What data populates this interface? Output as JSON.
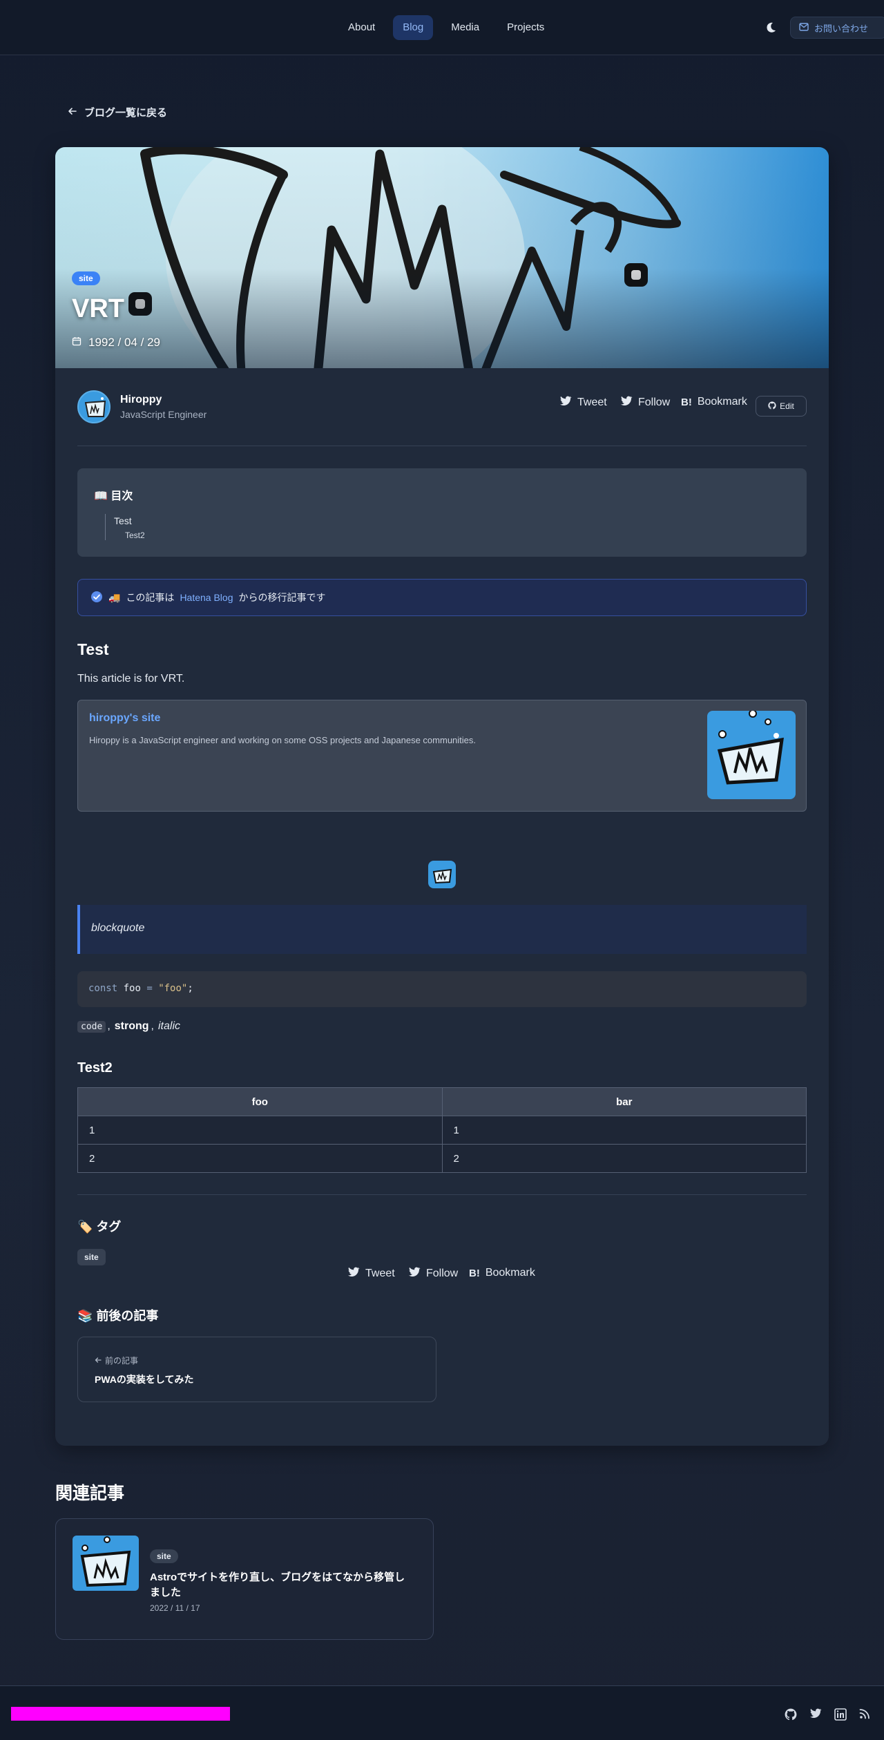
{
  "nav": {
    "items": [
      {
        "label": "About",
        "active": false
      },
      {
        "label": "Blog",
        "active": true
      },
      {
        "label": "Media",
        "active": false
      },
      {
        "label": "Projects",
        "active": false
      }
    ],
    "contact_label": "お問い合わせ"
  },
  "back_link": "ブログ一覧に戻る",
  "hero": {
    "tag": "site",
    "title": "VRT",
    "date": "1992 / 04 / 29"
  },
  "author": {
    "name": "Hiroppy",
    "role": "JavaScript Engineer"
  },
  "share": {
    "tweet": "Tweet",
    "follow": "Follow",
    "bookmark": "Bookmark",
    "edit": "Edit"
  },
  "toc": {
    "title": "目次",
    "items": [
      "Test",
      "Test2"
    ]
  },
  "notice": {
    "prefix": "この記事は",
    "link": "Hatena Blog",
    "suffix": "からの移行記事です"
  },
  "article": {
    "heading1": "Test",
    "paragraph": "This article is for VRT.",
    "link_card": {
      "title": "hiroppy's site",
      "description": "Hiroppy is a JavaScript engineer and working on some OSS projects and Japanese communities."
    },
    "blockquote": "blockquote",
    "code": {
      "keyword": "const",
      "name": "foo",
      "op": "=",
      "string": "\"foo\"",
      "end": ";"
    },
    "inline": {
      "code": "code",
      "sep1": ",",
      "strong": "strong",
      "sep2": ",",
      "italic": "italic"
    },
    "heading2": "Test2",
    "table": {
      "headers": [
        "foo",
        "bar"
      ],
      "rows": [
        [
          "1",
          "1"
        ],
        [
          "2",
          "2"
        ]
      ]
    }
  },
  "tags": {
    "title": "タグ",
    "items": [
      "site"
    ]
  },
  "prev_next": {
    "title": "前後の記事",
    "prev_label": "前の記事",
    "prev_title": "PWAの実装をしてみた"
  },
  "related": {
    "title": "関連記事",
    "items": [
      {
        "tag": "site",
        "title": "Astroでサイトを作り直し、ブログをはてなから移管しました",
        "date": "2022 / 11 / 17"
      }
    ]
  },
  "colors": {
    "accent": "#3b82f6",
    "active_nav_bg": "#1e3566",
    "footer_bar": "#ff00ff"
  }
}
